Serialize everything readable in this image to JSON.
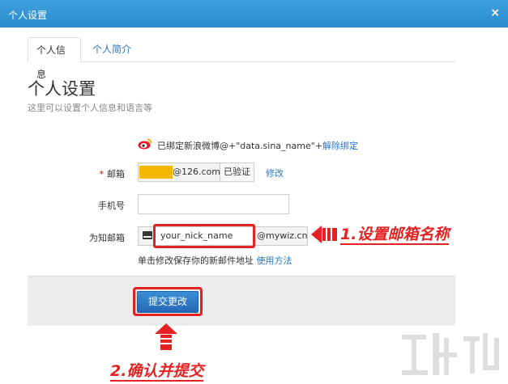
{
  "dialog": {
    "title": "个人设置",
    "close": "×"
  },
  "tabs": [
    {
      "label": "个人信息",
      "active": true
    },
    {
      "label": "个人简介",
      "active": false
    }
  ],
  "page": {
    "heading": "个人设置",
    "subtitle": "这里可以设置个人信息和语言等"
  },
  "weibo": {
    "text": "已绑定新浪微博@+\"data.sina_name\"+",
    "unbind_link": "解除绑定"
  },
  "form": {
    "email_label": "邮箱",
    "email_required": "*",
    "email_suffix": "@126.com",
    "email_verified": "已验证",
    "modify_link": "修改",
    "phone_label": "手机号",
    "phone_value": "",
    "wiz_label": "为知邮箱",
    "wiz_value": "your_nick_name",
    "wiz_domain": "@mywiz.cn",
    "help_text": "单击修改保存你的新邮件地址 ",
    "help_link": "使用方法",
    "submit_label": "提交更改"
  },
  "annotations": {
    "step1": "1.设置邮箱名称",
    "step2": "2.确认并提交",
    "accent_color": "#e52222"
  },
  "colors": {
    "titlebar": "#2b8ccc",
    "link": "#2a76c5",
    "mask": "#f5b800"
  }
}
